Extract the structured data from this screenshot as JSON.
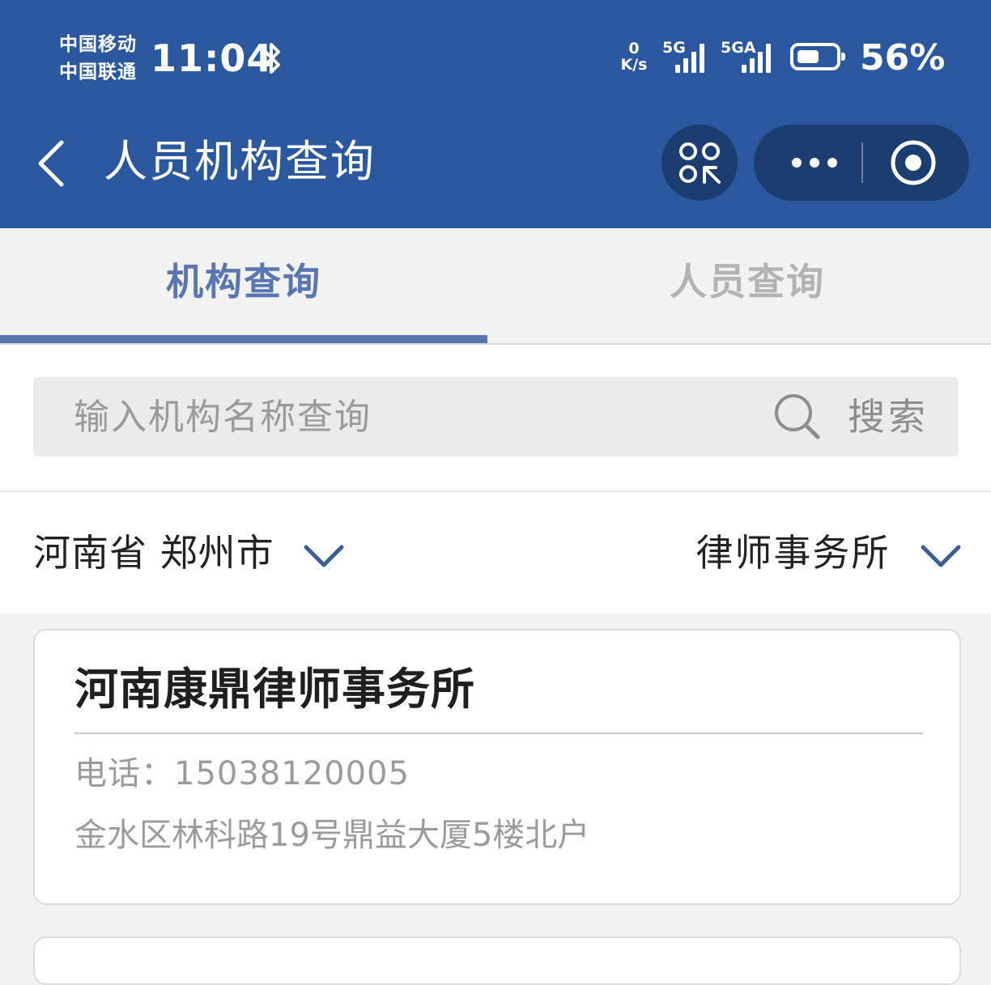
{
  "status_bar": {
    "carrier_1": "中国移动",
    "carrier_2": "中国联通",
    "time": "11:04",
    "net_speed_value": "0",
    "net_speed_unit": "K/s",
    "signal_1_label": "5G",
    "signal_2_label": "5GA",
    "battery_percent": "56%",
    "battery_level": 0.56,
    "icons": [
      "bluetooth-icon",
      "signal-icon",
      "battery-icon"
    ]
  },
  "nav": {
    "title": "人员机构查询",
    "icons": [
      "back-icon",
      "scan-switch-icon",
      "more-icon",
      "close-target-icon"
    ]
  },
  "tabs": [
    {
      "label": "机构查询",
      "active": true
    },
    {
      "label": "人员查询",
      "active": false
    }
  ],
  "search": {
    "placeholder": "输入机构名称查询",
    "value": "",
    "button_label": "搜索"
  },
  "filters": {
    "region": "河南省 郑州市",
    "category": "律师事务所"
  },
  "results": [
    {
      "name": "河南康鼎律师事务所",
      "phone": "电话：15038120005",
      "address": "金水区林科路19号鼎益大厦5楼北户"
    }
  ],
  "colors": {
    "header_bg": "#2a579e",
    "capsule_bg": "#1c3d6f",
    "accent": "#5a76b0",
    "page_bg": "#f2f2f2"
  }
}
